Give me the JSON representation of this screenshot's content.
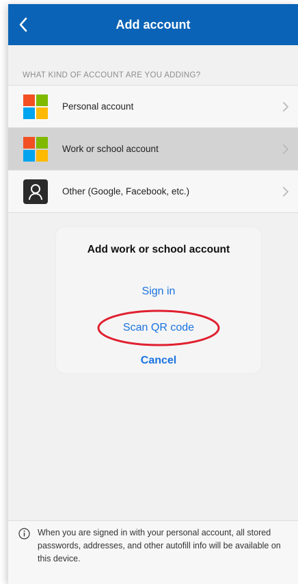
{
  "navbar": {
    "title": "Add account",
    "back_icon": "chevron-left-icon"
  },
  "section": {
    "header": "WHAT KIND OF ACCOUNT ARE YOU ADDING?"
  },
  "accounts": [
    {
      "label": "Personal account",
      "icon": "microsoft-logo-icon",
      "highlighted": false
    },
    {
      "label": "Work or school account",
      "icon": "microsoft-logo-icon",
      "highlighted": true
    },
    {
      "label": "Other (Google, Facebook, etc.)",
      "icon": "person-icon",
      "highlighted": false
    }
  ],
  "dialog": {
    "title": "Add work or school account",
    "sign_in": "Sign in",
    "scan_qr": "Scan QR code",
    "cancel": "Cancel"
  },
  "footer": {
    "info_icon": "info-icon",
    "text": "When you are signed in with your personal account, all stored passwords, addresses, and other autofill info will be available on this device."
  },
  "colors": {
    "brand_blue": "#0a63b6",
    "action_blue": "#1973e0",
    "highlight_red": "#e02030",
    "ms_red": "#f25022",
    "ms_green": "#7fba00",
    "ms_blue": "#00a4ef",
    "ms_yellow": "#ffb900"
  }
}
